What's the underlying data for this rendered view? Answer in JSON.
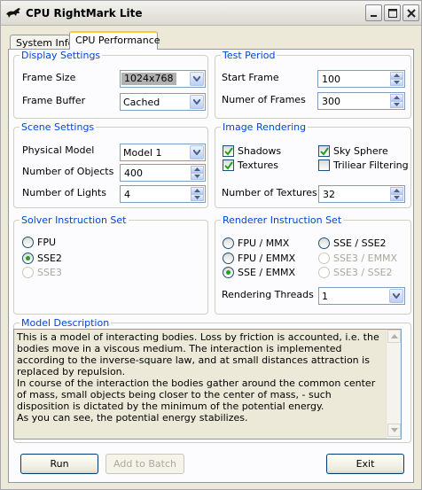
{
  "window": {
    "title": "CPU RightMark Lite"
  },
  "tabs": [
    {
      "label": "System Info",
      "active": false
    },
    {
      "label": "CPU Performance",
      "active": true
    }
  ],
  "display_settings": {
    "title": "Display Settings",
    "frame_size": {
      "label": "Frame Size",
      "value": "1024x768"
    },
    "frame_buffer": {
      "label": "Frame Buffer",
      "value": "Cached"
    }
  },
  "test_period": {
    "title": "Test Period",
    "start_frame": {
      "label": "Start Frame",
      "value": "100"
    },
    "num_frames": {
      "label": "Numer of Frames",
      "value": "300"
    }
  },
  "scene_settings": {
    "title": "Scene Settings",
    "physical_model": {
      "label": "Physical Model",
      "value": "Model 1"
    },
    "num_objects": {
      "label": "Number of Objects",
      "value": "400"
    },
    "num_lights": {
      "label": "Number of Lights",
      "value": "4"
    }
  },
  "image_rendering": {
    "title": "Image Rendering",
    "shadows": {
      "label": "Shadows",
      "checked": true
    },
    "sky_sphere": {
      "label": "Sky Sphere",
      "checked": true
    },
    "textures": {
      "label": "Textures",
      "checked": true
    },
    "trilinear": {
      "label": "Triliear Filtering",
      "checked": false
    },
    "num_textures": {
      "label": "Number of Textures",
      "value": "32"
    }
  },
  "solver": {
    "title": "Solver Instruction Set",
    "options": [
      {
        "label": "FPU",
        "selected": false,
        "enabled": true
      },
      {
        "label": "SSE2",
        "selected": true,
        "enabled": true
      },
      {
        "label": "SSE3",
        "selected": false,
        "enabled": false
      }
    ]
  },
  "renderer": {
    "title": "Renderer Instruction Set",
    "options": [
      {
        "label": "FPU / MMX",
        "selected": false,
        "enabled": true
      },
      {
        "label": "SSE / SSE2",
        "selected": false,
        "enabled": true
      },
      {
        "label": "FPU / EMMX",
        "selected": false,
        "enabled": true
      },
      {
        "label": "SSE3 / EMMX",
        "selected": false,
        "enabled": false
      },
      {
        "label": "SSE / EMMX",
        "selected": true,
        "enabled": true
      },
      {
        "label": "SSE3 / SSE2",
        "selected": false,
        "enabled": false
      }
    ],
    "threads": {
      "label": "Rendering Threads",
      "value": "1"
    }
  },
  "model_description": {
    "title": "Model Description",
    "paragraphs": [
      "This is a model of interacting bodies. Loss by friction is accounted, i.e. the bodies move in a viscous medium. The interaction is implemented according to the inverse-square law, and at small distances attraction is replaced by repulsion.",
      "In course of the interaction the bodies gather around the common center of mass, small objects being closer to the center of mass, - such disposition is dictated by the minimum of the potential energy.",
      "As you can see, the potential energy stabilizes."
    ]
  },
  "buttons": {
    "run": "Run",
    "add_to_batch": "Add to Batch",
    "exit": "Exit"
  },
  "colors": {
    "group_title": "#0046d5",
    "tab_highlight": "#ffc83c",
    "radio_dot": "#21a121"
  },
  "icons": {
    "app": "panther-icon",
    "minimize": "minimize-icon",
    "maximize": "maximize-icon",
    "close": "close-icon"
  }
}
